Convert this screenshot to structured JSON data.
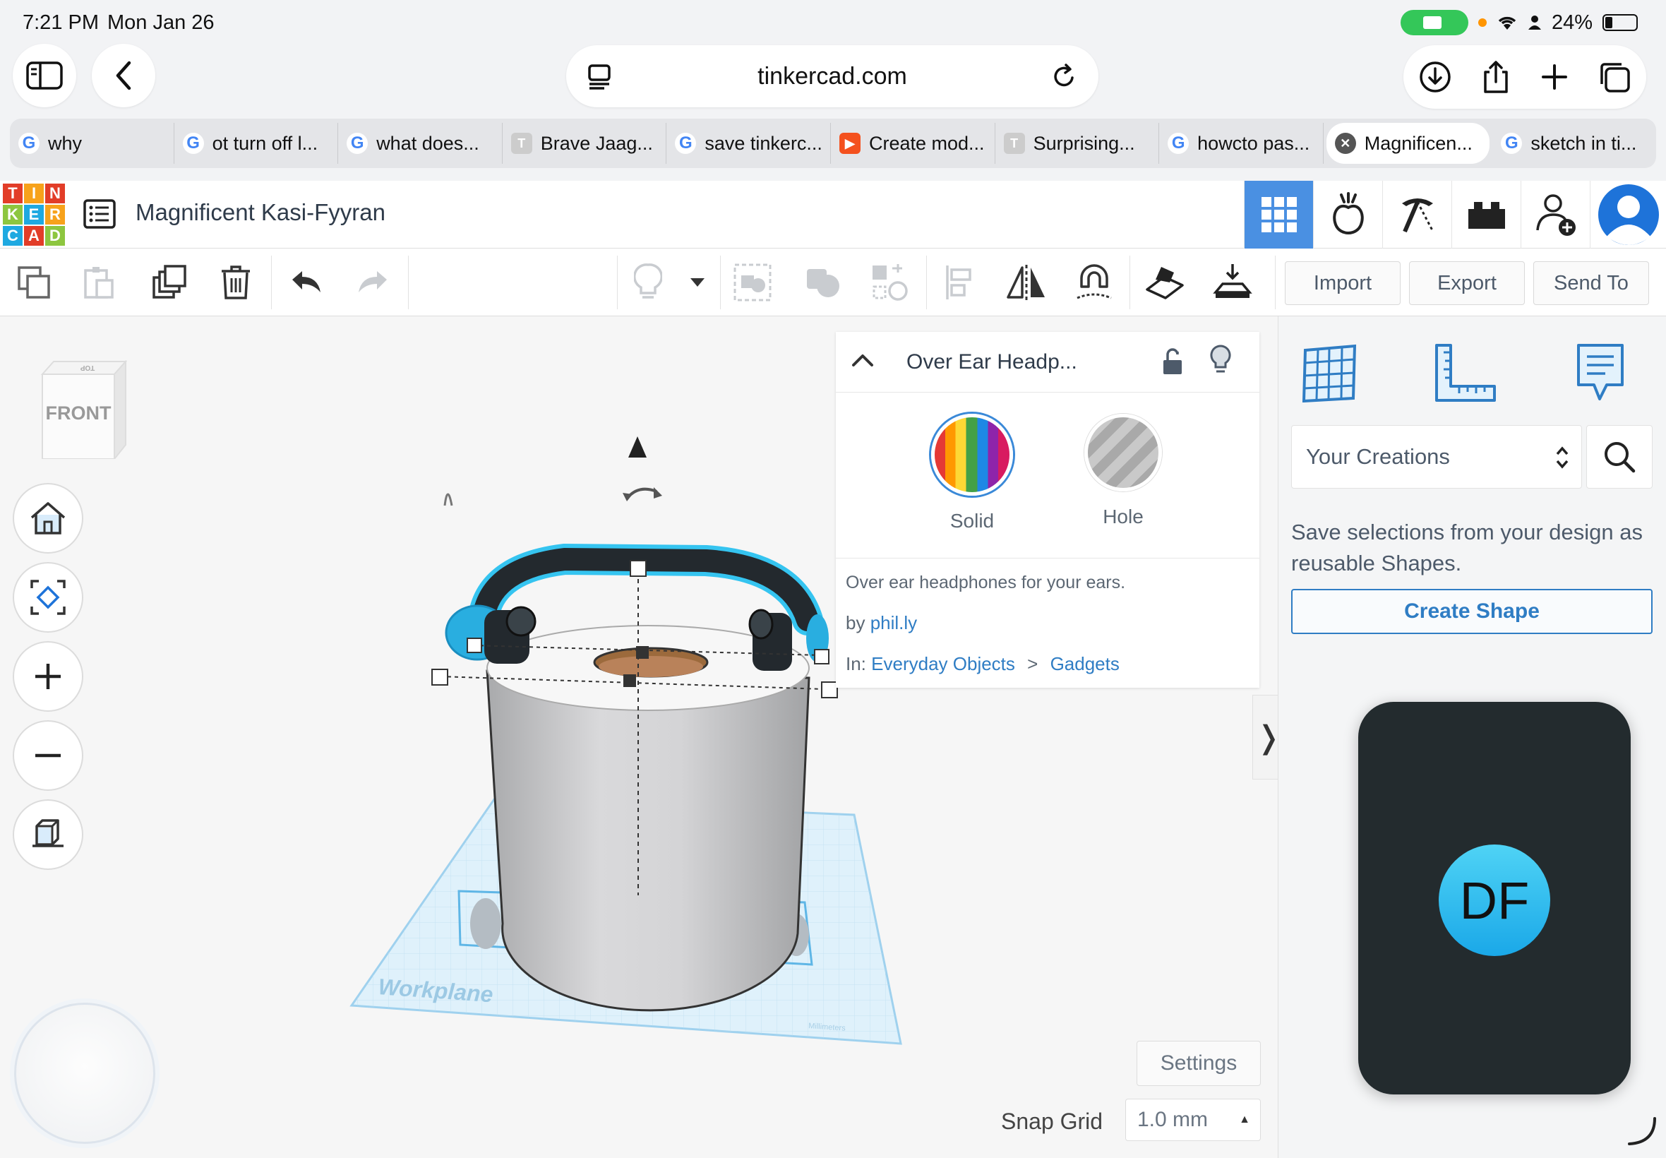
{
  "status": {
    "time": "7:21 PM",
    "date": "Mon Jan 26",
    "battery": "24%"
  },
  "browser": {
    "url": "tinkercad.com",
    "tabs": [
      {
        "label": "why",
        "icon": "google-icon"
      },
      {
        "label": "ot turn off l...",
        "icon": "google-icon"
      },
      {
        "label": "what does...",
        "icon": "google-icon"
      },
      {
        "label": "Brave Jaag...",
        "icon": "tinkercad-icon"
      },
      {
        "label": "save tinkerc...",
        "icon": "google-icon"
      },
      {
        "label": "Create mod...",
        "icon": "clipchamp-icon"
      },
      {
        "label": "Surprising...",
        "icon": "tinkercad-icon"
      },
      {
        "label": "howcto pas...",
        "icon": "google-icon"
      },
      {
        "label": "Magnificen...",
        "icon": "close-icon",
        "active": true
      },
      {
        "label": "sketch in ti...",
        "icon": "google-icon"
      }
    ]
  },
  "app": {
    "logo_letters": [
      "T",
      "I",
      "N",
      "K",
      "E",
      "R",
      "C",
      "A",
      "D"
    ],
    "design_title": "Magnificent Kasi-Fyyran"
  },
  "toolbar": {
    "import": "Import",
    "export": "Export",
    "send_to": "Send To"
  },
  "viewcube": {
    "face": "FRONT",
    "top": "TOP"
  },
  "workplane": {
    "label": "Workplane",
    "units": "Millimeters"
  },
  "inspector": {
    "title": "Over Ear Headp...",
    "solid": "Solid",
    "hole": "Hole",
    "description": "Over ear headphones for your ears.",
    "by_prefix": "by",
    "author": "phil.ly",
    "in_prefix": "In:",
    "category": "Everyday Objects",
    "separator": ">",
    "subcategory": "Gadgets"
  },
  "settings": "Settings",
  "snap": {
    "label": "Snap Grid",
    "value": "1.0 mm"
  },
  "panel": {
    "dropdown": "Your Creations",
    "help_text": "Save selections from your design as reusable Shapes.",
    "create_shape": "Create Shape"
  },
  "facetime": {
    "initials": "DF"
  },
  "colors": {
    "accent": "#4a90e2",
    "link": "#2f7dc4",
    "selection": "#1ab0e8"
  }
}
